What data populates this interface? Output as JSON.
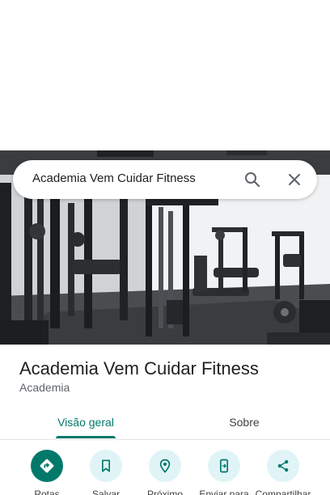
{
  "search": {
    "query": "Academia Vem Cuidar Fitness"
  },
  "place": {
    "name": "Academia Vem Cuidar Fitness",
    "category": "Academia"
  },
  "tabs": [
    {
      "label": "Visão geral",
      "active": true
    },
    {
      "label": "Sobre",
      "active": false
    }
  ],
  "actions": [
    {
      "label": "Rotas",
      "icon": "directions-icon"
    },
    {
      "label": "Salvar",
      "icon": "bookmark-icon"
    },
    {
      "label": "Próximo",
      "icon": "nearby-icon"
    },
    {
      "label": "Enviar para",
      "icon": "send-to-phone-icon"
    },
    {
      "label": "Compartilhar",
      "icon": "share-icon"
    }
  ],
  "colors": {
    "accent": "#00796b",
    "action_bg": "#e0f4f7",
    "text_primary": "#202124",
    "text_secondary": "#5f6368"
  }
}
